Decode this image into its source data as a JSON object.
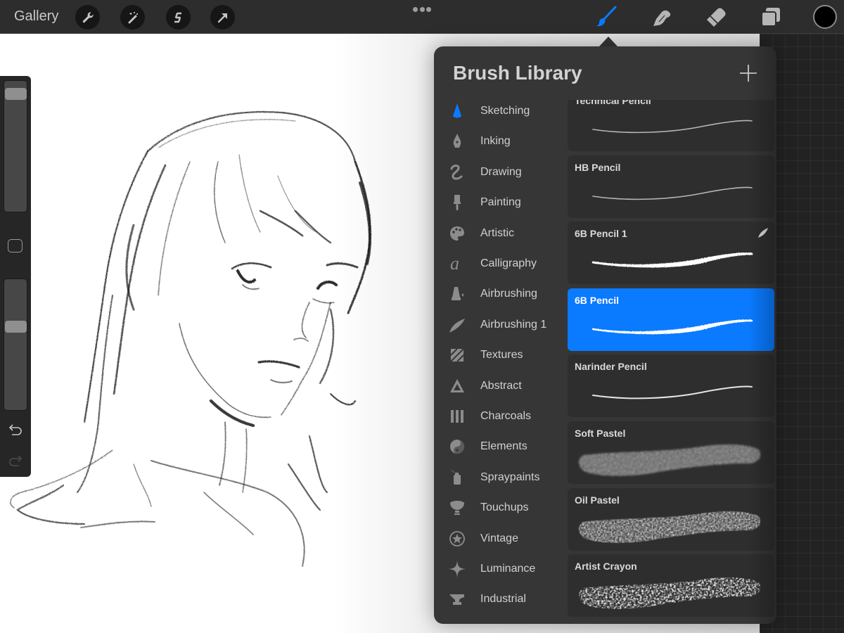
{
  "topbar": {
    "gallery_label": "Gallery",
    "left_tools": [
      {
        "name": "actions",
        "icon": "wrench-icon"
      },
      {
        "name": "adjustments",
        "icon": "magic-wand-icon"
      },
      {
        "name": "selection",
        "icon": "selection-s-icon"
      },
      {
        "name": "transform",
        "icon": "arrow-cursor-icon"
      }
    ],
    "more_icon": "ellipsis-icon",
    "right_tools": [
      {
        "name": "brush",
        "icon": "brush-icon",
        "active": true
      },
      {
        "name": "smudge",
        "icon": "smudge-finger-icon",
        "active": false
      },
      {
        "name": "eraser",
        "icon": "eraser-icon",
        "active": false
      },
      {
        "name": "layers",
        "icon": "layers-icon",
        "active": false
      }
    ],
    "current_color": "#000000",
    "accent_color": "#0a7aff"
  },
  "sidebar": {
    "brush_size_level": 0.94,
    "opacity_level": 0.65,
    "modify_icon": "square-modify-icon",
    "undo_icon": "undo-icon",
    "redo_icon": "redo-icon"
  },
  "brush_library": {
    "title": "Brush Library",
    "add_icon": "plus-icon",
    "categories": [
      {
        "label": "Sketching",
        "icon": "pencil-tip-icon",
        "selected": true
      },
      {
        "label": "Inking",
        "icon": "pen-nib-icon",
        "selected": false
      },
      {
        "label": "Drawing",
        "icon": "squiggle-icon",
        "selected": false
      },
      {
        "label": "Painting",
        "icon": "paintbrush-icon",
        "selected": false
      },
      {
        "label": "Artistic",
        "icon": "palette-icon",
        "selected": false
      },
      {
        "label": "Calligraphy",
        "icon": "script-a-icon",
        "selected": false
      },
      {
        "label": "Airbrushing",
        "icon": "airbrush-icon",
        "selected": false
      },
      {
        "label": "Airbrushing 1",
        "icon": "feather-stroke-icon",
        "selected": false
      },
      {
        "label": "Textures",
        "icon": "hatch-square-icon",
        "selected": false
      },
      {
        "label": "Abstract",
        "icon": "triangle-icon",
        "selected": false
      },
      {
        "label": "Charcoals",
        "icon": "charcoal-sticks-icon",
        "selected": false
      },
      {
        "label": "Elements",
        "icon": "yin-yang-icon",
        "selected": false
      },
      {
        "label": "Spraypaints",
        "icon": "spray-can-icon",
        "selected": false
      },
      {
        "label": "Touchups",
        "icon": "makeup-brush-icon",
        "selected": false
      },
      {
        "label": "Vintage",
        "icon": "star-circle-icon",
        "selected": false
      },
      {
        "label": "Luminance",
        "icon": "sparkle-icon",
        "selected": false
      },
      {
        "label": "Industrial",
        "icon": "anvil-icon",
        "selected": false
      }
    ],
    "brushes": [
      {
        "name": "Technical Pencil",
        "stroke": "thin",
        "selected": false,
        "imported": false
      },
      {
        "name": "HB Pencil",
        "stroke": "thin",
        "selected": false,
        "imported": false
      },
      {
        "name": "6B Pencil 1",
        "stroke": "medium",
        "selected": false,
        "imported": true
      },
      {
        "name": "6B Pencil",
        "stroke": "medium",
        "selected": true,
        "imported": false
      },
      {
        "name": "Narinder Pencil",
        "stroke": "thin-solid",
        "selected": false,
        "imported": false
      },
      {
        "name": "Soft Pastel",
        "stroke": "wide-soft",
        "selected": false,
        "imported": false
      },
      {
        "name": "Oil Pastel",
        "stroke": "wide-rough",
        "selected": false,
        "imported": false
      },
      {
        "name": "Artist Crayon",
        "stroke": "wide-crayon",
        "selected": false,
        "imported": false
      }
    ]
  }
}
